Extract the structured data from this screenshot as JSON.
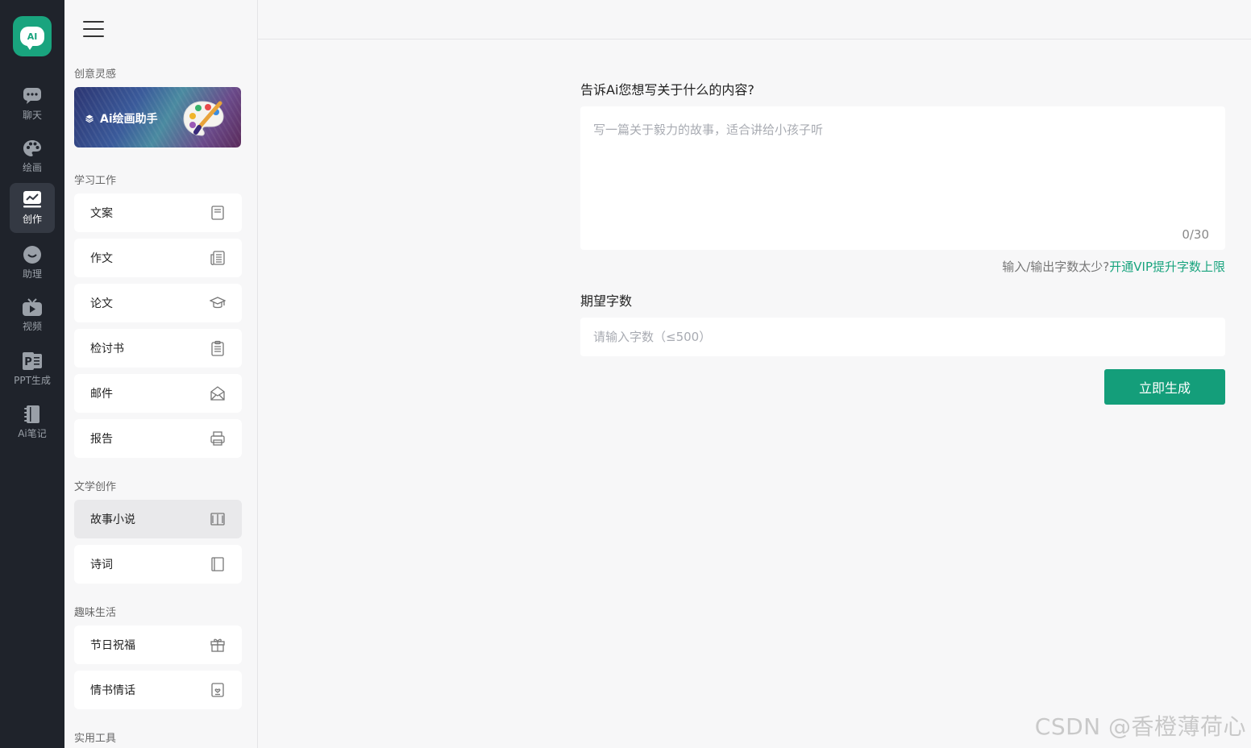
{
  "logo": {
    "text": "AI"
  },
  "rail": {
    "items": [
      {
        "label": "聊天",
        "icon": "chat-icon"
      },
      {
        "label": "绘画",
        "icon": "palette-icon"
      },
      {
        "label": "创作",
        "icon": "create-icon",
        "active": true
      },
      {
        "label": "助理",
        "icon": "assistant-icon"
      },
      {
        "label": "视频",
        "icon": "video-icon"
      },
      {
        "label": "PPT生成",
        "icon": "ppt-icon"
      },
      {
        "label": "Ai笔记",
        "icon": "notebook-icon"
      }
    ]
  },
  "sidebar": {
    "sections": {
      "inspiration": "创意灵感",
      "study_work": "学习工作",
      "literature": "文学创作",
      "fun_life": "趣味生活",
      "tools": "实用工具"
    },
    "banner": {
      "label": "Ai绘画助手"
    },
    "items": [
      {
        "label": "文案",
        "icon": "document-icon"
      },
      {
        "label": "作文",
        "icon": "newspaper-icon"
      },
      {
        "label": "论文",
        "icon": "graduation-cap-icon"
      },
      {
        "label": "检讨书",
        "icon": "clipboard-icon"
      },
      {
        "label": "邮件",
        "icon": "envelope-icon"
      },
      {
        "label": "报告",
        "icon": "printer-icon"
      },
      {
        "label": "故事小说",
        "icon": "book-open-icon",
        "selected": true
      },
      {
        "label": "诗词",
        "icon": "book-icon"
      },
      {
        "label": "节日祝福",
        "icon": "gift-icon"
      },
      {
        "label": "情书情话",
        "icon": "love-letter-icon"
      }
    ]
  },
  "form": {
    "question_label": "告诉Ai您想写关于什么的内容?",
    "content_placeholder": "写一篇关于毅力的故事，适合讲给小孩子听",
    "counter": "0/30",
    "hint_text": "输入/输出字数太少?",
    "hint_link": "开通VIP提升字数上限",
    "words_label": "期望字数",
    "words_placeholder": "请输入字数（≤500）",
    "submit_label": "立即生成"
  },
  "watermark": "CSDN @香橙薄荷心",
  "colors": {
    "accent": "#149e7a",
    "rail_bg": "#1f232b",
    "link": "#19a47e"
  }
}
